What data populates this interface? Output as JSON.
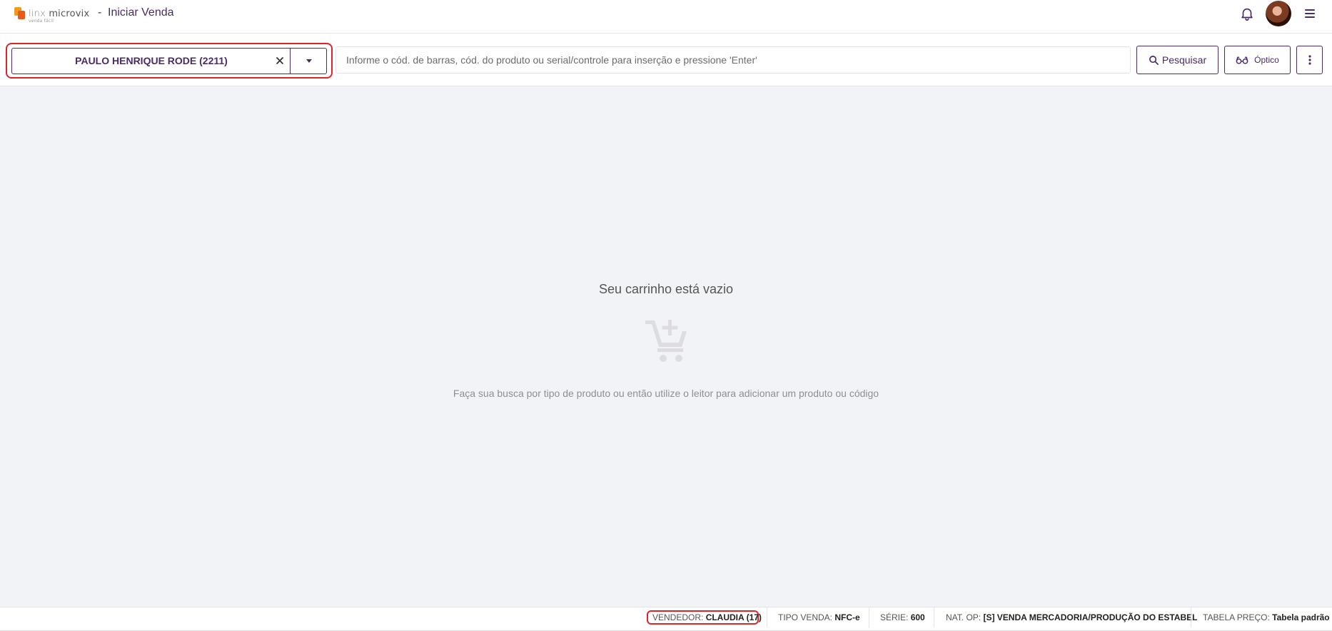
{
  "header": {
    "brand": {
      "linx": "linx",
      "microvix": "microvix",
      "sub": "venda fácil"
    },
    "separator": "-",
    "title": "Iniciar Venda"
  },
  "toolbar": {
    "client": {
      "name": "PAULO HENRIQUE RODE (2211)"
    },
    "search": {
      "placeholder": "Informe o cód. de barras, cód. do produto ou serial/controle para inserção e pressione 'Enter'"
    },
    "search_button": "Pesquisar",
    "optico_button": "Óptico"
  },
  "main": {
    "empty_title": "Seu carrinho está vazio",
    "empty_hint": "Faça sua busca por tipo de produto ou então utilize o leitor para adicionar um produto ou código"
  },
  "status": {
    "vendedor": {
      "label": "VENDEDOR:",
      "value": "CLAUDIA (17)"
    },
    "tipo_venda": {
      "label": "TIPO VENDA:",
      "value": "NFC-e"
    },
    "serie": {
      "label": "SÉRIE:",
      "value": "600"
    },
    "nat_op": {
      "label": "NAT. OP:",
      "value": "[S] VENDA MERCADORIA/PRODUÇÃO DO ESTABEL"
    },
    "tabela_preco": {
      "label": "TABELA PREÇO:",
      "value": "Tabela padrão"
    }
  },
  "colors": {
    "primary": "#4a2b68",
    "highlight": "#e0242c",
    "background": "#f2f3f6",
    "logo_orange": "#f39a1e"
  },
  "icons": [
    "bell-icon",
    "avatar",
    "hamburger-menu-icon",
    "close-icon",
    "caret-down-icon",
    "search-icon",
    "glasses-icon",
    "more-vertical-icon",
    "cart-add-icon"
  ]
}
